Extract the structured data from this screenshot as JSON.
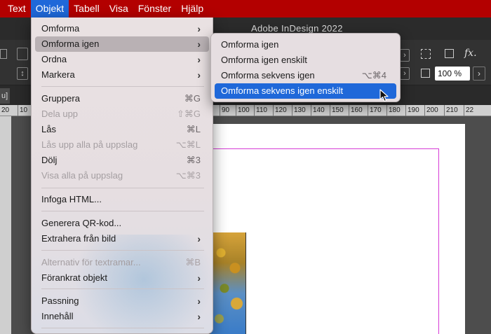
{
  "menubar": {
    "items": [
      "Text",
      "Objekt",
      "Tabell",
      "Visa",
      "Fönster",
      "Hjälp"
    ],
    "active_index": 1
  },
  "app": {
    "title": "Adobe InDesign 2022",
    "tab_label": "u]"
  },
  "controlbar": {
    "scale_value": "100 %",
    "fx_label": "fx."
  },
  "ruler": {
    "labels": [
      "20",
      "10",
      "90",
      "100",
      "110",
      "120",
      "130",
      "140",
      "150",
      "160",
      "170",
      "180",
      "190",
      "200",
      "210",
      "22"
    ]
  },
  "menu": {
    "items": [
      {
        "label": "Omforma",
        "submenu": true,
        "disabled": false
      },
      {
        "label": "Omforma igen",
        "submenu": true,
        "disabled": false,
        "highlighted": true
      },
      {
        "label": "Ordna",
        "submenu": true,
        "disabled": false
      },
      {
        "label": "Markera",
        "submenu": true,
        "disabled": false
      },
      {
        "label": "Gruppera",
        "shortcut": "⌘G",
        "disabled": false
      },
      {
        "label": "Dela upp",
        "shortcut": "⇧⌘G",
        "disabled": true
      },
      {
        "label": "Lås",
        "shortcut": "⌘L",
        "disabled": false
      },
      {
        "label": "Lås upp alla på uppslag",
        "shortcut": "⌥⌘L",
        "disabled": true
      },
      {
        "label": "Dölj",
        "shortcut": "⌘3",
        "disabled": false
      },
      {
        "label": "Visa alla på uppslag",
        "shortcut": "⌥⌘3",
        "disabled": true
      },
      {
        "label": "Infoga HTML...",
        "disabled": false
      },
      {
        "label": "Generera QR-kod...",
        "disabled": false
      },
      {
        "label": "Extrahera från bild",
        "submenu": true,
        "disabled": false
      },
      {
        "label": "Alternativ för textramar...",
        "shortcut": "⌘B",
        "disabled": true
      },
      {
        "label": "Förankrat objekt",
        "submenu": true,
        "disabled": false
      },
      {
        "label": "Passning",
        "submenu": true,
        "disabled": false
      },
      {
        "label": "Innehåll",
        "submenu": true,
        "disabled": false
      }
    ]
  },
  "submenu": {
    "items": [
      {
        "label": "Omforma igen"
      },
      {
        "label": "Omforma igen enskilt"
      },
      {
        "label": "Omforma sekvens igen",
        "shortcut": "⌥⌘4"
      },
      {
        "label": "Omforma sekvens igen enskilt",
        "active": true
      }
    ]
  },
  "colors": {
    "menubar": "#b30000",
    "selection": "#1f68d9",
    "margin_guide": "#d63bd6"
  }
}
